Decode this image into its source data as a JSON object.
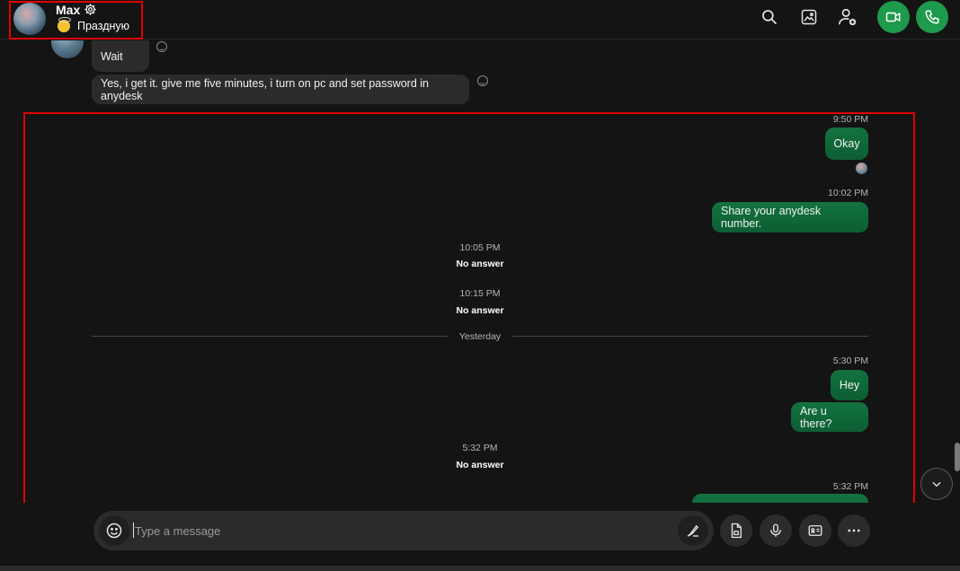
{
  "header": {
    "contact_name": "Max",
    "status_text": "Праздную",
    "icons": [
      "search-icon",
      "gallery-icon",
      "add-people-icon",
      "video-call-icon",
      "audio-call-icon"
    ],
    "call_color": "#1d9a4c"
  },
  "messages": {
    "incoming": [
      {
        "text": "Wait"
      },
      {
        "text": "Yes, i get it. give me five minutes, i turn on pc and set password in anydesk"
      }
    ],
    "outgoing_1": {
      "time": "9:50 PM",
      "text": "Okay"
    },
    "outgoing_2": {
      "time": "10:02 PM",
      "text": "Share your anydesk number."
    },
    "system_1": {
      "time": "10:05 PM",
      "text": "No answer"
    },
    "system_2": {
      "time": "10:15 PM",
      "text": "No answer"
    },
    "divider": "Yesterday",
    "outgoing_3": {
      "time": "5:30 PM",
      "texts": [
        "Hey",
        "Are u there?"
      ]
    },
    "system_3": {
      "time": "5:32 PM",
      "text": "No answer"
    },
    "outgoing_4": {
      "time": "5:32 PM"
    }
  },
  "composer": {
    "placeholder": "Type a message",
    "value": ""
  },
  "colors": {
    "background": "#141414",
    "bubble_in": "#2b2b2b",
    "bubble_out": "#0f6b3b",
    "highlight": "#e00000"
  }
}
